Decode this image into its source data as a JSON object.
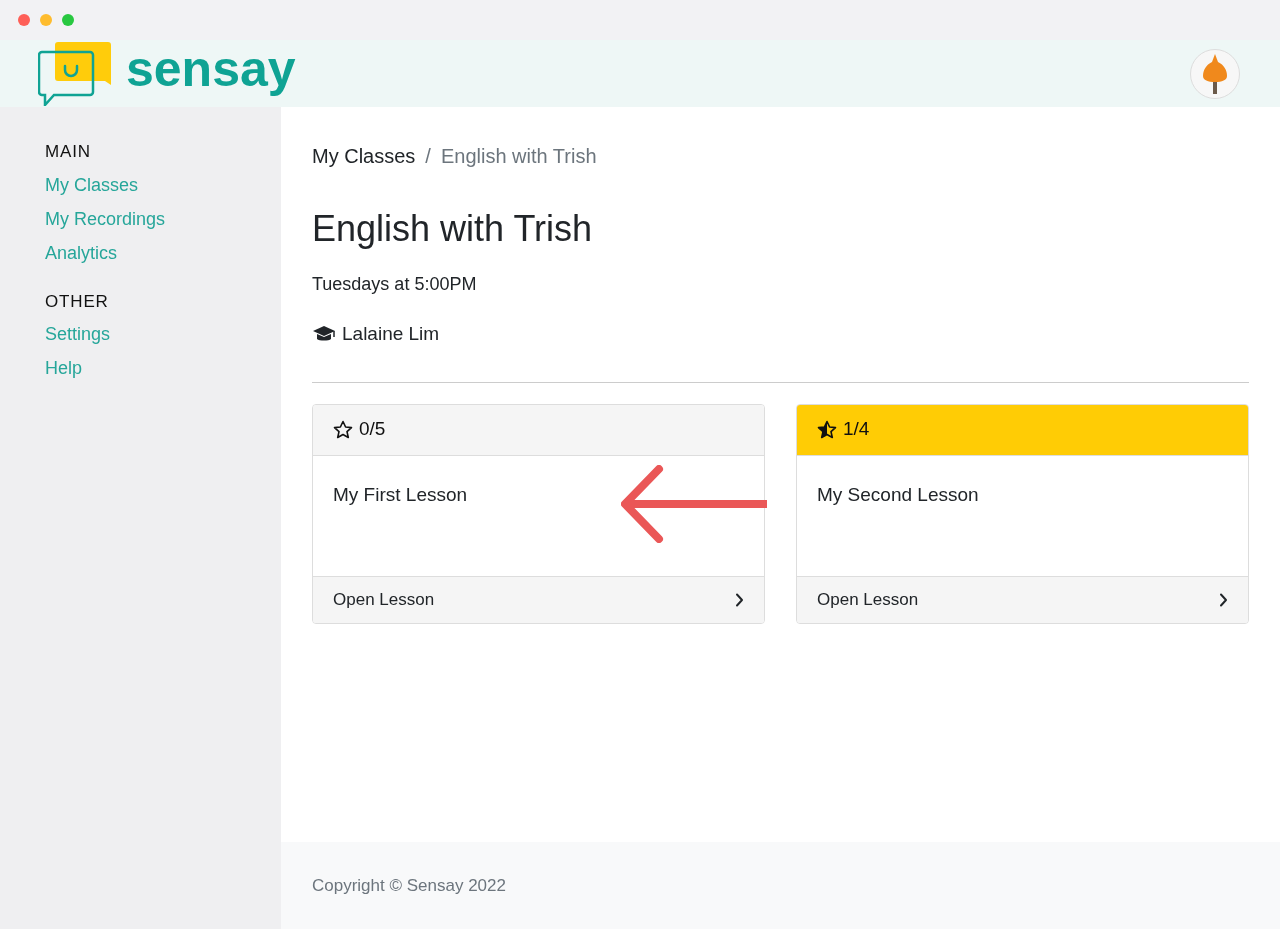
{
  "header": {
    "logo_text": "sensay"
  },
  "sidebar": {
    "sections": [
      {
        "heading": "MAIN",
        "items": [
          "My Classes",
          "My Recordings",
          "Analytics"
        ]
      },
      {
        "heading": "OTHER",
        "items": [
          "Settings",
          "Help"
        ]
      }
    ]
  },
  "breadcrumb": {
    "items": [
      "My Classes",
      "English with Trish"
    ],
    "separator": "/"
  },
  "class": {
    "title": "English with Trish",
    "schedule": "Tuesdays at 5:00PM",
    "teacher": "Lalaine Lim"
  },
  "lessons": [
    {
      "score": "0/5",
      "highlighted": false,
      "title": "My First Lesson",
      "action": "Open Lesson"
    },
    {
      "score": "1/4",
      "highlighted": true,
      "title": "My Second Lesson",
      "action": "Open Lesson"
    }
  ],
  "footer": "Copyright © Sensay 2022"
}
